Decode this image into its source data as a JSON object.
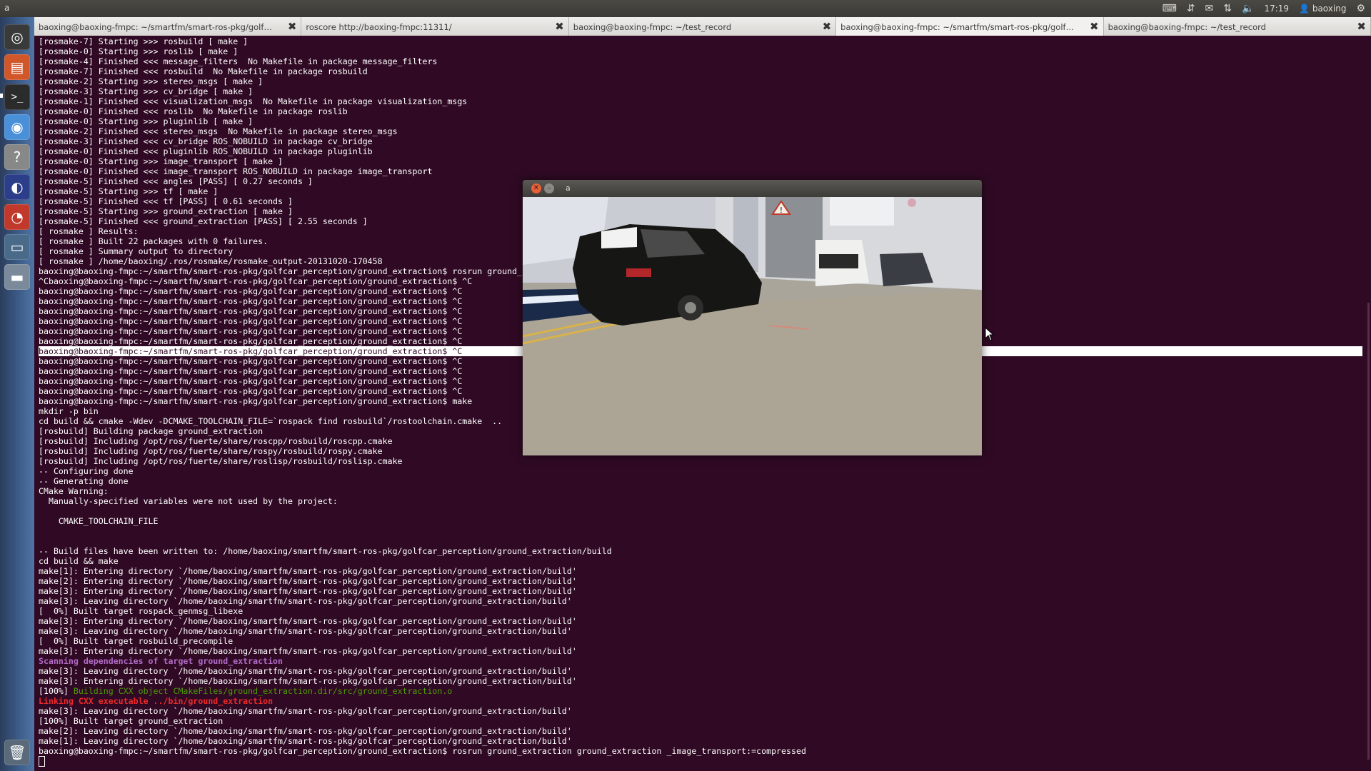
{
  "top_panel": {
    "app_title": "a",
    "clock": "17:19",
    "user": "baoxing",
    "indicators": [
      "keyboard-icon",
      "network-icon",
      "mail-icon",
      "transfer-icon",
      "volume-icon"
    ]
  },
  "launcher": {
    "items": [
      "dash-home-icon",
      "files-icon",
      "terminal-icon",
      "browser-icon",
      "help-icon",
      "eclipse-icon",
      "pdf-reader-icon",
      "system-monitor-icon",
      "drive-icon",
      "trash-icon"
    ]
  },
  "terminal": {
    "tabs": [
      {
        "label": "baoxing@baoxing-fmpc: ~/smartfm/smart-ros-pkg/golfcar_percepti...",
        "active": false
      },
      {
        "label": "roscore http://baoxing-fmpc:11311/",
        "active": false
      },
      {
        "label": "baoxing@baoxing-fmpc: ~/test_record",
        "active": false
      },
      {
        "label": "baoxing@baoxing-fmpc: ~/smartfm/smart-ros-pkg/golfcar_percepti...",
        "active": true
      },
      {
        "label": "baoxing@baoxing-fmpc: ~/test_record",
        "active": false
      }
    ],
    "lines": [
      {
        "text": "[rosmake-7] Starting >>> rosbuild [ make ]",
        "style": ""
      },
      {
        "text": "[rosmake-0] Starting >>> roslib [ make ]",
        "style": ""
      },
      {
        "text": "[rosmake-4] Finished <<< message_filters  No Makefile in package message_filters",
        "style": ""
      },
      {
        "text": "[rosmake-7] Finished <<< rosbuild  No Makefile in package rosbuild",
        "style": ""
      },
      {
        "text": "[rosmake-2] Starting >>> stereo_msgs [ make ]",
        "style": ""
      },
      {
        "text": "[rosmake-3] Starting >>> cv_bridge [ make ]",
        "style": ""
      },
      {
        "text": "[rosmake-1] Finished <<< visualization_msgs  No Makefile in package visualization_msgs",
        "style": ""
      },
      {
        "text": "[rosmake-0] Finished <<< roslib  No Makefile in package roslib",
        "style": ""
      },
      {
        "text": "[rosmake-0] Starting >>> pluginlib [ make ]",
        "style": ""
      },
      {
        "text": "[rosmake-2] Finished <<< stereo_msgs  No Makefile in package stereo_msgs",
        "style": ""
      },
      {
        "text": "[rosmake-3] Finished <<< cv_bridge ROS_NOBUILD in package cv_bridge",
        "style": ""
      },
      {
        "text": "[rosmake-0] Finished <<< pluginlib ROS_NOBUILD in package pluginlib",
        "style": ""
      },
      {
        "text": "[rosmake-0] Starting >>> image_transport [ make ]",
        "style": ""
      },
      {
        "text": "[rosmake-0] Finished <<< image_transport ROS_NOBUILD in package image_transport",
        "style": ""
      },
      {
        "text": "[rosmake-5] Finished <<< angles [PASS] [ 0.27 seconds ]",
        "style": ""
      },
      {
        "text": "[rosmake-5] Starting >>> tf [ make ]",
        "style": ""
      },
      {
        "text": "[rosmake-5] Finished <<< tf [PASS] [ 0.61 seconds ]",
        "style": ""
      },
      {
        "text": "[rosmake-5] Starting >>> ground_extraction [ make ]",
        "style": ""
      },
      {
        "text": "[rosmake-5] Finished <<< ground_extraction [PASS] [ 2.55 seconds ]",
        "style": ""
      },
      {
        "text": "[ rosmake ] Results:",
        "style": ""
      },
      {
        "text": "[ rosmake ] Built 22 packages with 0 failures.",
        "style": ""
      },
      {
        "text": "[ rosmake ] Summary output to directory",
        "style": ""
      },
      {
        "text": "[ rosmake ] /home/baoxing/.ros/rosmake/rosmake_output-20131020-170458",
        "style": ""
      },
      {
        "text": "baoxing@baoxing-fmpc:~/smartfm/smart-ros-pkg/golfcar_perception/ground_extraction$ rosrun ground_",
        "style": ""
      },
      {
        "text": "^Cbaoxing@baoxing-fmpc:~/smartfm/smart-ros-pkg/golfcar_perception/ground_extraction$ ^C",
        "style": ""
      },
      {
        "text": "baoxing@baoxing-fmpc:~/smartfm/smart-ros-pkg/golfcar_perception/ground_extraction$ ^C",
        "style": ""
      },
      {
        "text": "baoxing@baoxing-fmpc:~/smartfm/smart-ros-pkg/golfcar_perception/ground_extraction$ ^C",
        "style": ""
      },
      {
        "text": "baoxing@baoxing-fmpc:~/smartfm/smart-ros-pkg/golfcar_perception/ground_extraction$ ^C",
        "style": ""
      },
      {
        "text": "baoxing@baoxing-fmpc:~/smartfm/smart-ros-pkg/golfcar_perception/ground_extraction$ ^C",
        "style": ""
      },
      {
        "text": "baoxing@baoxing-fmpc:~/smartfm/smart-ros-pkg/golfcar_perception/ground_extraction$ ^C",
        "style": ""
      },
      {
        "text": "baoxing@baoxing-fmpc:~/smartfm/smart-ros-pkg/golfcar_perception/ground_extraction$ ^C",
        "style": ""
      },
      {
        "text": "baoxing@baoxing-fmpc:~/smartfm/smart-ros-pkg/golfcar_perception/ground_extraction$ ^C",
        "style": "highlight"
      },
      {
        "text": "baoxing@baoxing-fmpc:~/smartfm/smart-ros-pkg/golfcar_perception/ground_extraction$ ^C",
        "style": ""
      },
      {
        "text": "baoxing@baoxing-fmpc:~/smartfm/smart-ros-pkg/golfcar_perception/ground_extraction$ ^C",
        "style": ""
      },
      {
        "text": "baoxing@baoxing-fmpc:~/smartfm/smart-ros-pkg/golfcar_perception/ground_extraction$ ^C",
        "style": ""
      },
      {
        "text": "baoxing@baoxing-fmpc:~/smartfm/smart-ros-pkg/golfcar_perception/ground_extraction$ ^C",
        "style": ""
      },
      {
        "text": "baoxing@baoxing-fmpc:~/smartfm/smart-ros-pkg/golfcar_perception/ground_extraction$ make",
        "style": ""
      },
      {
        "text": "mkdir -p bin",
        "style": ""
      },
      {
        "text": "cd build && cmake -Wdev -DCMAKE_TOOLCHAIN_FILE=`rospack find rosbuild`/rostoolchain.cmake  ..",
        "style": ""
      },
      {
        "text": "[rosbuild] Building package ground_extraction",
        "style": ""
      },
      {
        "text": "[rosbuild] Including /opt/ros/fuerte/share/roscpp/rosbuild/roscpp.cmake",
        "style": ""
      },
      {
        "text": "[rosbuild] Including /opt/ros/fuerte/share/rospy/rosbuild/rospy.cmake",
        "style": ""
      },
      {
        "text": "[rosbuild] Including /opt/ros/fuerte/share/roslisp/rosbuild/roslisp.cmake",
        "style": ""
      },
      {
        "text": "-- Configuring done",
        "style": ""
      },
      {
        "text": "-- Generating done",
        "style": ""
      },
      {
        "text": "CMake Warning:",
        "style": ""
      },
      {
        "text": "  Manually-specified variables were not used by the project:",
        "style": ""
      },
      {
        "text": "",
        "style": ""
      },
      {
        "text": "    CMAKE_TOOLCHAIN_FILE",
        "style": ""
      },
      {
        "text": "",
        "style": ""
      },
      {
        "text": "",
        "style": ""
      },
      {
        "text": "-- Build files have been written to: /home/baoxing/smartfm/smart-ros-pkg/golfcar_perception/ground_extraction/build",
        "style": ""
      },
      {
        "text": "cd build && make",
        "style": ""
      },
      {
        "text": "make[1]: Entering directory `/home/baoxing/smartfm/smart-ros-pkg/golfcar_perception/ground_extraction/build'",
        "style": ""
      },
      {
        "text": "make[2]: Entering directory `/home/baoxing/smartfm/smart-ros-pkg/golfcar_perception/ground_extraction/build'",
        "style": ""
      },
      {
        "text": "make[3]: Entering directory `/home/baoxing/smartfm/smart-ros-pkg/golfcar_perception/ground_extraction/build'",
        "style": ""
      },
      {
        "text": "make[3]: Leaving directory `/home/baoxing/smartfm/smart-ros-pkg/golfcar_perception/ground_extraction/build'",
        "style": ""
      },
      {
        "text": "[  0%] Built target rospack_genmsg_libexe",
        "style": ""
      },
      {
        "text": "make[3]: Entering directory `/home/baoxing/smartfm/smart-ros-pkg/golfcar_perception/ground_extraction/build'",
        "style": ""
      },
      {
        "text": "make[3]: Leaving directory `/home/baoxing/smartfm/smart-ros-pkg/golfcar_perception/ground_extraction/build'",
        "style": ""
      },
      {
        "text": "[  0%] Built target rosbuild_precompile",
        "style": ""
      },
      {
        "text": "make[3]: Entering directory `/home/baoxing/smartfm/smart-ros-pkg/golfcar_perception/ground_extraction/build'",
        "style": ""
      },
      {
        "text": "Scanning dependencies of target ground_extraction",
        "style": "purple"
      },
      {
        "text": "make[3]: Leaving directory `/home/baoxing/smartfm/smart-ros-pkg/golfcar_perception/ground_extraction/build'",
        "style": ""
      },
      {
        "text": "make[3]: Entering directory `/home/baoxing/smartfm/smart-ros-pkg/golfcar_perception/ground_extraction/build'",
        "style": ""
      },
      {
        "text": "[100%] ",
        "style": "",
        "green_suffix": "Building CXX object CMakeFiles/ground_extraction.dir/src/ground_extraction.o"
      },
      {
        "text": "Linking CXX executable ../bin/ground_extraction",
        "style": "red"
      },
      {
        "text": "make[3]: Leaving directory `/home/baoxing/smartfm/smart-ros-pkg/golfcar_perception/ground_extraction/build'",
        "style": ""
      },
      {
        "text": "[100%] Built target ground_extraction",
        "style": ""
      },
      {
        "text": "make[2]: Leaving directory `/home/baoxing/smartfm/smart-ros-pkg/golfcar_perception/ground_extraction/build'",
        "style": ""
      },
      {
        "text": "make[1]: Leaving directory `/home/baoxing/smartfm/smart-ros-pkg/golfcar_perception/ground_extraction/build'",
        "style": ""
      },
      {
        "text": "baoxing@baoxing-fmpc:~/smartfm/smart-ros-pkg/golfcar_perception/ground_extraction$ rosrun ground_extraction ground_extraction _image_transport:=compressed",
        "style": ""
      }
    ]
  },
  "viewer": {
    "title": "a",
    "close_glyph": "✕",
    "min_glyph": "–",
    "image_description_icons": [
      "warning-sign-icon"
    ]
  },
  "colors": {
    "terminal_bg": "#300a24",
    "prompt_fg": "#ffffff",
    "purple": "#b16bc7",
    "green": "#4e9a06",
    "red": "#ef2929"
  }
}
